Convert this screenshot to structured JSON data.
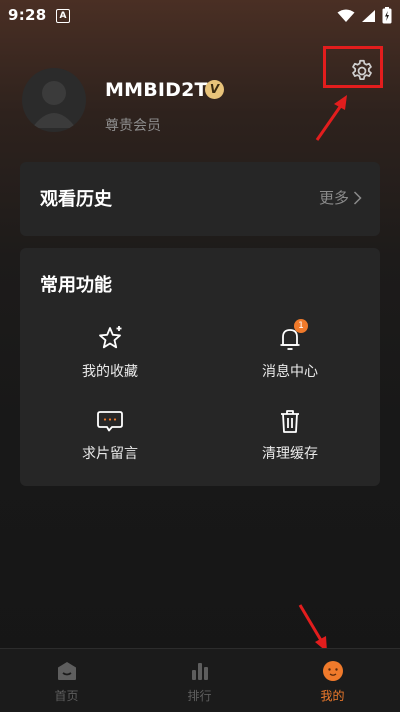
{
  "status_bar": {
    "time": "9:28",
    "notification_glyph": "A"
  },
  "profile": {
    "username": "MMBID2T",
    "vip_badge": "V",
    "member_label": "尊贵会员"
  },
  "history": {
    "title": "观看历史",
    "more_label": "更多"
  },
  "features": {
    "title": "常用功能",
    "items": [
      {
        "label": "我的收藏",
        "icon": "star-icon"
      },
      {
        "label": "消息中心",
        "icon": "bell-icon",
        "badge": "1"
      },
      {
        "label": "求片留言",
        "icon": "message-icon"
      },
      {
        "label": "清理缓存",
        "icon": "trash-icon"
      }
    ]
  },
  "tabs": [
    {
      "label": "首页",
      "icon": "home-icon",
      "active": false
    },
    {
      "label": "排行",
      "icon": "ranking-icon",
      "active": false
    },
    {
      "label": "我的",
      "icon": "mine-icon",
      "active": true
    }
  ],
  "colors": {
    "accent": "#f07a2b",
    "annotation": "#e21d1d",
    "card": "#262626",
    "vip_gold": "#e8c37a"
  }
}
